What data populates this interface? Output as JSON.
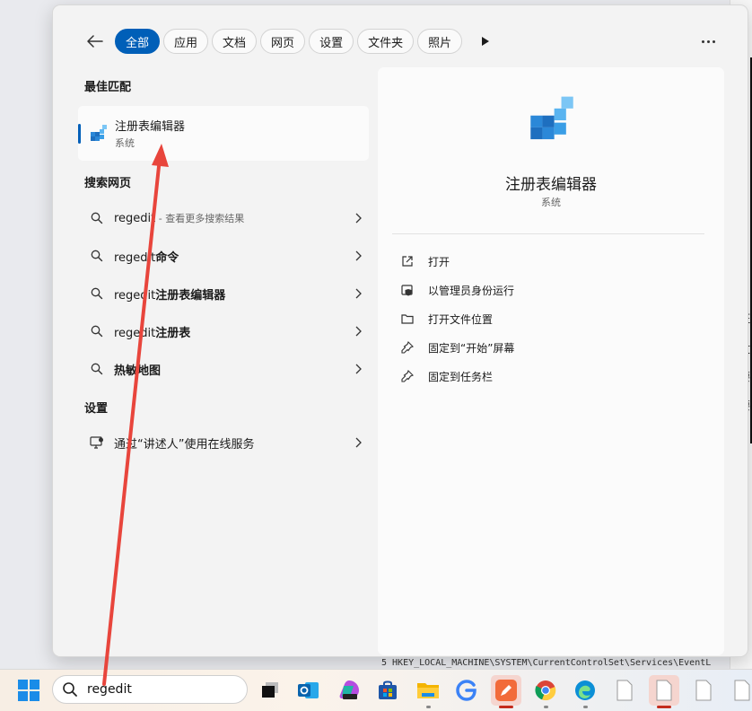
{
  "tabs": [
    {
      "label": "全部",
      "active": true
    },
    {
      "label": "应用"
    },
    {
      "label": "文档"
    },
    {
      "label": "网页"
    },
    {
      "label": "设置"
    },
    {
      "label": "文件夹"
    },
    {
      "label": "照片"
    }
  ],
  "sections": {
    "best_match": "最佳匹配",
    "search_web": "搜索网页",
    "settings": "设置"
  },
  "best_match": {
    "name": "注册表编辑器",
    "type": "系统",
    "icon": "registry-editor-icon"
  },
  "web_results": [
    {
      "prefix": "regedit",
      "bold": "",
      "suffix": " - 查看更多搜索结果"
    },
    {
      "prefix": "regedit",
      "bold": "命令",
      "suffix": ""
    },
    {
      "prefix": "regedit",
      "bold": "注册表编辑器",
      "suffix": ""
    },
    {
      "prefix": "regedit",
      "bold": "注册表",
      "suffix": ""
    },
    {
      "prefix": "",
      "bold": "热敏地图",
      "suffix": ""
    }
  ],
  "settings_results": [
    {
      "label": "通过“讲述人”使用在线服务"
    }
  ],
  "detail": {
    "title": "注册表编辑器",
    "subtitle": "系统",
    "actions": [
      {
        "label": "打开",
        "icon": "open-external-icon"
      },
      {
        "label": "以管理员身份运行",
        "icon": "shield-admin-icon"
      },
      {
        "label": "打开文件位置",
        "icon": "folder-open-icon"
      },
      {
        "label": "固定到“开始”屏幕",
        "icon": "pin-icon"
      },
      {
        "label": "固定到任务栏",
        "icon": "pin-icon"
      }
    ]
  },
  "taskbar": {
    "search_value": "regedit",
    "apps": [
      "task-view",
      "outlook",
      "m365",
      "store",
      "file-explorer",
      "g-app",
      "pen-app",
      "chrome",
      "edge",
      "document",
      "document-active",
      "document",
      "document"
    ]
  },
  "background": {
    "code_line": "5   HKEY_LOCAL_MACHINE\\SYSTEM\\CurrentControlSet\\Services\\EventL",
    "side_chars": [
      "班",
      "文",
      "要",
      "要"
    ]
  },
  "colors": {
    "accent": "#005fb8",
    "annotation": "#e8453c"
  }
}
